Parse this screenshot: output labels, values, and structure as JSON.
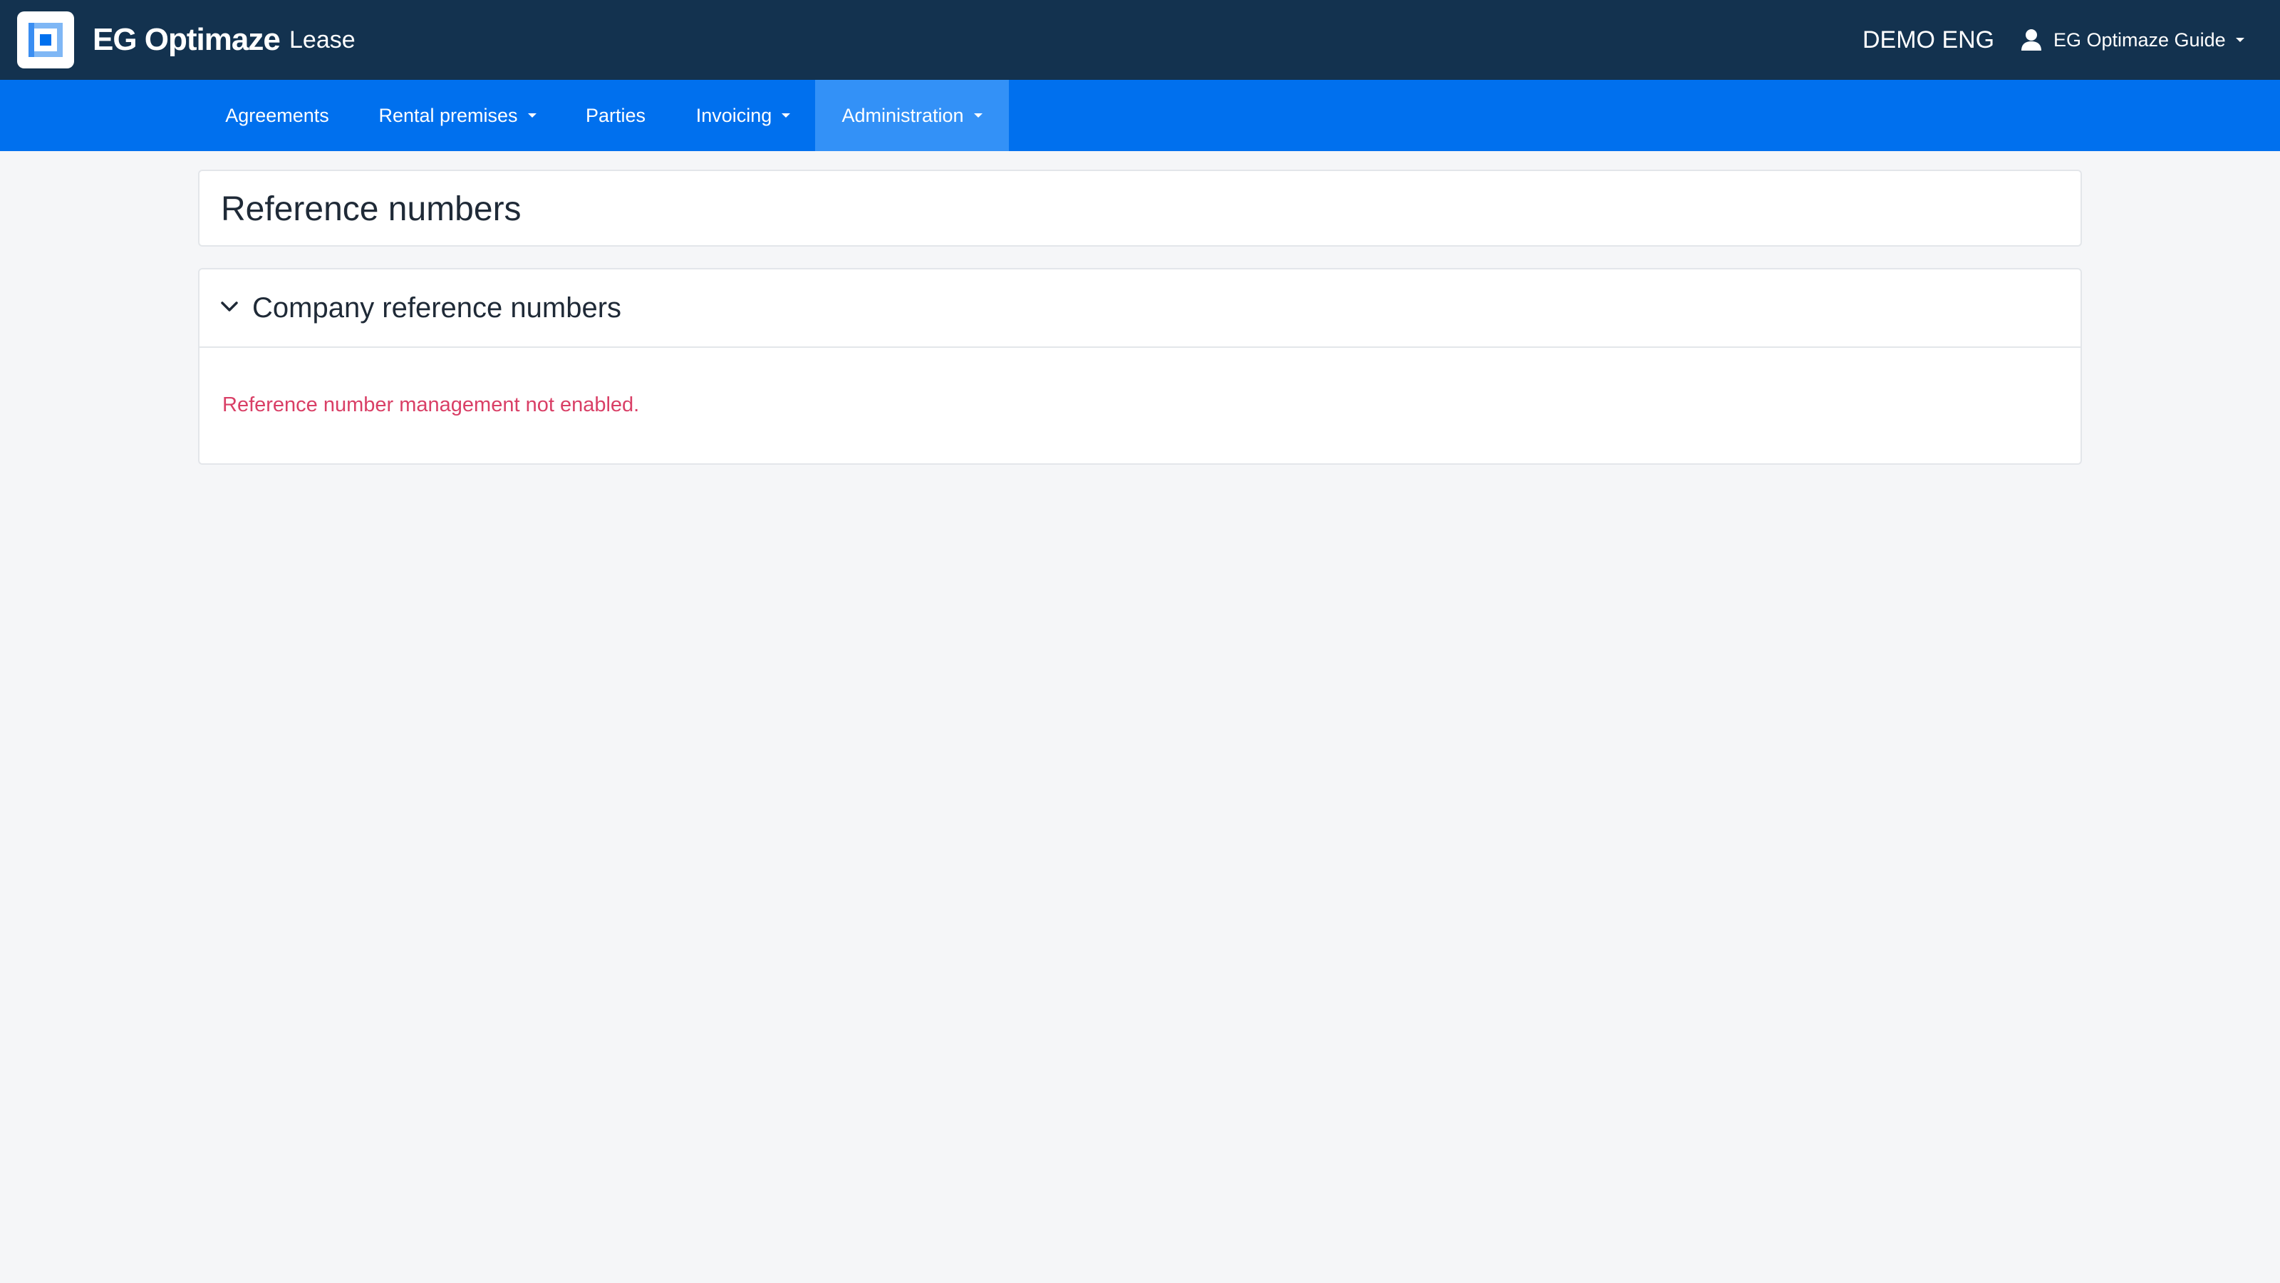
{
  "header": {
    "brand": "EG Optimaze",
    "module": "Lease",
    "tenant": "DEMO ENG",
    "user": "EG Optimaze Guide"
  },
  "nav": {
    "items": [
      {
        "label": "Agreements",
        "dropdown": false
      },
      {
        "label": "Rental premises",
        "dropdown": true
      },
      {
        "label": "Parties",
        "dropdown": false
      },
      {
        "label": "Invoicing",
        "dropdown": true
      },
      {
        "label": "Administration",
        "dropdown": true,
        "active": true
      }
    ]
  },
  "page": {
    "title": "Reference numbers",
    "section": {
      "title": "Company reference numbers",
      "expanded": true,
      "message": "Reference number management not enabled."
    }
  },
  "colors": {
    "topbar": "#13324f",
    "navbar": "#0070ee",
    "nav_active": "#3391f7",
    "error_text": "#d93f66",
    "background": "#f5f6f8"
  }
}
